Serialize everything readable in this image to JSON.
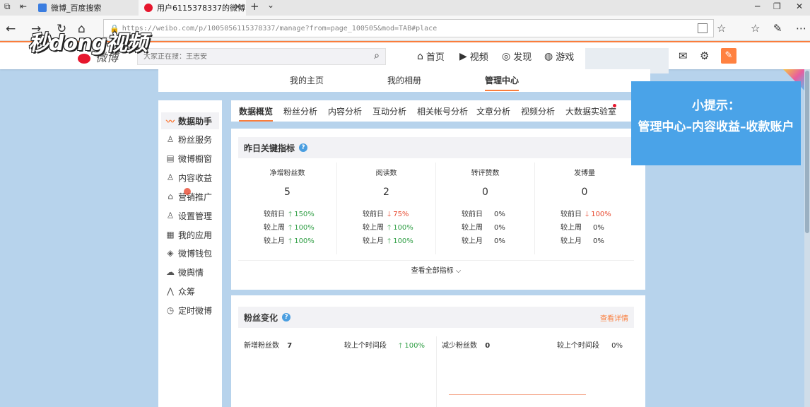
{
  "browser": {
    "tabs": [
      {
        "title": "微博_百度搜索",
        "active": false
      },
      {
        "title": "用户6115378337的微博",
        "active": true
      }
    ],
    "new_tab": "+",
    "tab_list": "⌄",
    "url": "https://weibo.com/p/1005056115378337/manage?from=page_100505&mod=TAB#place",
    "window_controls": {
      "minimize": "─",
      "restore": "❐",
      "close": "✕"
    }
  },
  "watermark": {
    "text": "秒dong视频"
  },
  "weibo_header": {
    "logo": "微博",
    "search_placeholder": "大家正在搜：王志安",
    "nav": [
      {
        "label": "首页",
        "icon": "home-icon"
      },
      {
        "label": "视频",
        "icon": "video-icon"
      },
      {
        "label": "发现",
        "icon": "compass-icon"
      },
      {
        "label": "游戏",
        "icon": "gamepad-icon"
      }
    ]
  },
  "top_tabs": [
    "我的主页",
    "我的相册",
    "管理中心"
  ],
  "top_tab_active": "管理中心",
  "sidebar": {
    "items": [
      {
        "label": "数据助手",
        "icon": "chart-line-icon"
      },
      {
        "label": "粉丝服务",
        "icon": "user-gear-icon"
      },
      {
        "label": "微博橱窗",
        "icon": "store-icon"
      },
      {
        "label": "内容收益",
        "icon": "user-coin-icon"
      },
      {
        "label": "营销推广",
        "icon": "bag-icon"
      },
      {
        "label": "设置管理",
        "icon": "user-settings-icon"
      },
      {
        "label": "我的应用",
        "icon": "grid-icon"
      },
      {
        "label": "微博钱包",
        "icon": "wallet-icon"
      },
      {
        "label": "微舆情",
        "icon": "sentiment-icon"
      },
      {
        "label": "众筹",
        "icon": "crowdfund-icon"
      },
      {
        "label": "定时微博",
        "icon": "timer-icon"
      }
    ],
    "active": "数据助手"
  },
  "sub_tabs": [
    "数据概览",
    "粉丝分析",
    "内容分析",
    "互动分析",
    "相关帐号分析",
    "文章分析",
    "视频分析",
    "大数据实验室"
  ],
  "sub_tab_active": "数据概览",
  "key_metrics": {
    "title": "昨日关键指标",
    "help": "?",
    "columns": [
      {
        "title": "净增粉丝数",
        "value": "5",
        "rows": [
          {
            "label": "较前日",
            "dir": "up",
            "pct": "150%"
          },
          {
            "label": "较上周",
            "dir": "up",
            "pct": "100%"
          },
          {
            "label": "较上月",
            "dir": "up",
            "pct": "100%"
          }
        ]
      },
      {
        "title": "阅读数",
        "value": "2",
        "rows": [
          {
            "label": "较前日",
            "dir": "down",
            "pct": "75%"
          },
          {
            "label": "较上周",
            "dir": "up",
            "pct": "100%"
          },
          {
            "label": "较上月",
            "dir": "up",
            "pct": "100%"
          }
        ]
      },
      {
        "title": "转评赞数",
        "value": "0",
        "rows": [
          {
            "label": "较前日",
            "dir": "none",
            "pct": "0%"
          },
          {
            "label": "较上周",
            "dir": "none",
            "pct": "0%"
          },
          {
            "label": "较上月",
            "dir": "none",
            "pct": "0%"
          }
        ]
      },
      {
        "title": "发博量",
        "value": "0",
        "rows": [
          {
            "label": "较前日",
            "dir": "down",
            "pct": "100%"
          },
          {
            "label": "较上周",
            "dir": "none",
            "pct": "0%"
          },
          {
            "label": "较上月",
            "dir": "none",
            "pct": "0%"
          }
        ]
      }
    ],
    "see_all": "查看全部指标 ⌵"
  },
  "fans_change": {
    "title": "粉丝变化",
    "help": "?",
    "details_link": "查看详情",
    "new_fans_label": "新增粉丝数",
    "new_fans_value": "7",
    "new_fans_compare_label": "较上个时间段",
    "new_fans_compare_pct": "100%",
    "lost_fans_label": "减少粉丝数",
    "lost_fans_value": "0",
    "lost_fans_compare_label": "较上个时间段",
    "lost_fans_compare_pct": "0%"
  },
  "tip": {
    "title": "小提示：",
    "body": "管理中心–内容收益–收款账户"
  },
  "colors": {
    "accent": "#fa7d3c",
    "up": "#2f9e44",
    "down": "#e8492f",
    "tip_bg": "#4aa3e8",
    "page_bg": "#b7d3ec"
  }
}
